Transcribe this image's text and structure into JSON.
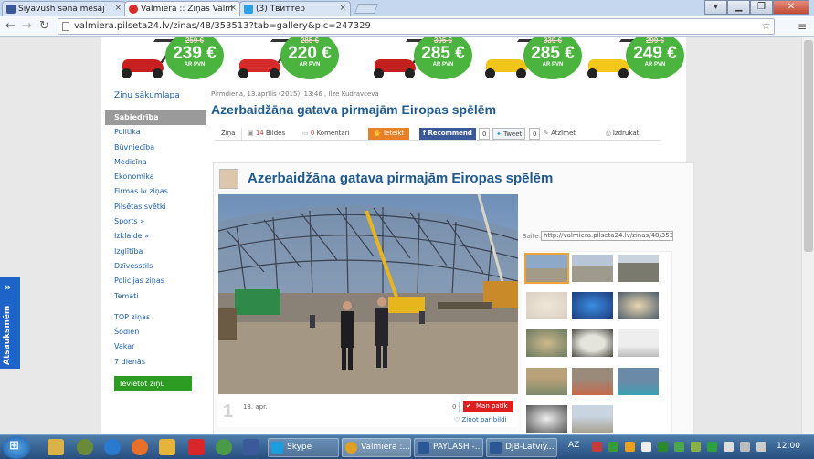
{
  "browser": {
    "tabs": [
      {
        "label": "Siyavush səna mesaj",
        "favicon_color": "#3b5998"
      },
      {
        "label": "Valmiera :: Ziņas Valm",
        "favicon_color": "#d92c2c"
      },
      {
        "label": "(3) Твиттер",
        "favicon_color": "#2aa0e8"
      }
    ],
    "url": "valmiera.pilseta24.lv/zinas/48/353513?tab=gallery&pic=247329",
    "window_buttons": [
      "▁",
      "❐",
      "✕"
    ]
  },
  "sidebar": {
    "home": "Ziņu sākumlapa",
    "items": [
      "Sabiedrība",
      "Politika",
      "Būvniecība",
      "Medicīna",
      "Ekonomika",
      "Firmas.lv ziņas",
      "Pilsētas svētki",
      "Sports »",
      "Izklaide »",
      "Izglītība",
      "Dzīvesstils",
      "Policijas ziņas",
      "Temati"
    ],
    "items2": [
      "TOP ziņas",
      "Šodien",
      "Vakar",
      "7 dienās"
    ],
    "submit_button": "Ievietot ziņu"
  },
  "banner": {
    "prices": [
      {
        "old": "259 €",
        "new": "239 €",
        "vat": "AR PVN"
      },
      {
        "old": "285 €",
        "new": "220 €",
        "vat": "AR PVN"
      },
      {
        "old": "305 €",
        "new": "285 €",
        "vat": "AR PVN"
      },
      {
        "old": "339 €",
        "new": "285 €",
        "vat": "AR PVN"
      },
      {
        "old": "299 €",
        "new": "249 €",
        "vat": "AR PVN"
      }
    ]
  },
  "article": {
    "meta": "Pirmdiena, 13.aprīlis (2015), 13:46 , Ilze Kudravceva",
    "title": "Azerbaidžāna gatava pirmajām Eiropas spēlēm",
    "share": {
      "tab_news": "Ziņa",
      "photos_count": "14",
      "photos_label": "Bildes",
      "comments_count": "0",
      "comments_label": "Komentāri",
      "ieteikt": "Ieteikt",
      "recommend": "Recommend",
      "recommend_count": "0",
      "tweet": "Tweet",
      "tweet_count": "0",
      "mark": "Atzīmēt",
      "print": "Izdrukāt"
    }
  },
  "gallery": {
    "title": "Azerbaidžāna gatava pirmajām Eiropas spēlēm",
    "link_label": "Saite:",
    "link_value": "http://valmiera.pilseta24.lv/zinas/48/353513?",
    "photo_number": "1",
    "photo_date": "13. apr.",
    "like_count": "0",
    "like_label": "Man patīk",
    "favorite_label": "Ziņot par bildi",
    "thumbnail_count": 14
  },
  "side_tab": {
    "label": "Atsauksmēm",
    "arrows": "»"
  },
  "taskbar": {
    "tasks": [
      "Skype",
      "Valmiera :...",
      "PAYLASH -...",
      "DJB-Latviy..."
    ],
    "language": "AZ",
    "clock": "12:00"
  },
  "colors": {
    "link": "#1b5ea8",
    "title": "#1f5a8f",
    "accent_green": "#2d9c22",
    "price_green": "#4ab43f",
    "like_red": "#dd1f1f"
  }
}
